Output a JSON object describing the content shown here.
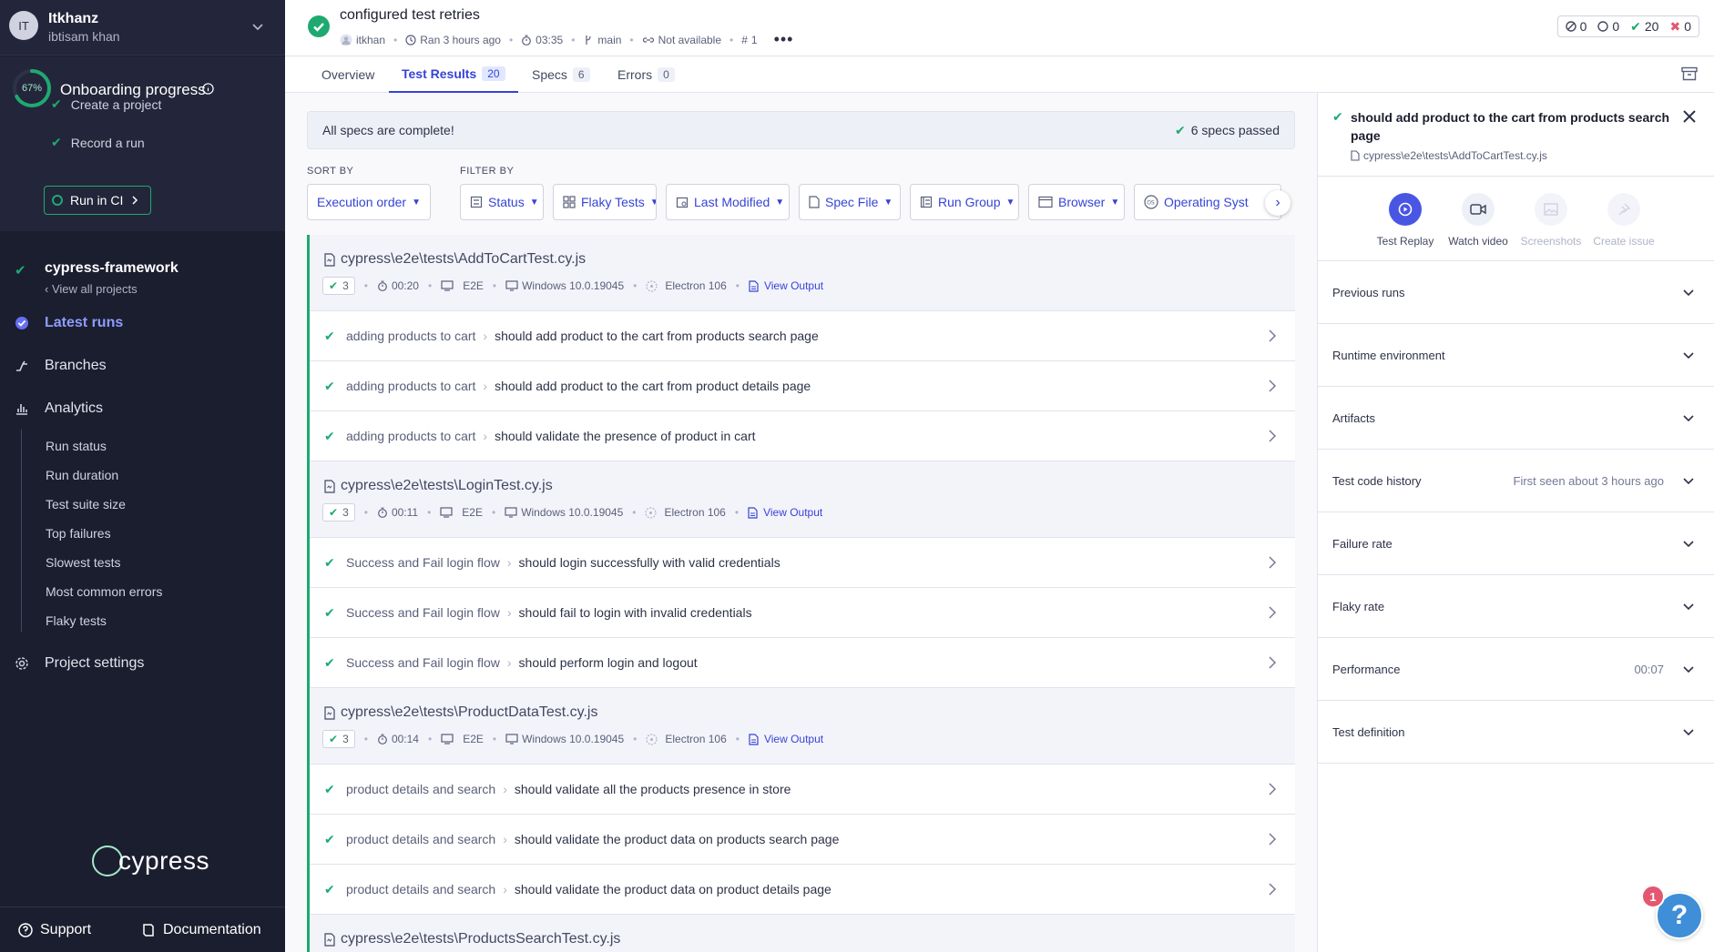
{
  "org": {
    "initials": "IT",
    "name": "Itkhanz",
    "user": "ibtisam khan"
  },
  "onboarding": {
    "percent": "67%",
    "progress": 0.67,
    "title": "Onboarding progress",
    "steps": [
      "Create a project",
      "Record a run"
    ],
    "cta": "Run in CI"
  },
  "project": {
    "name": "cypress-framework",
    "link": "View all projects"
  },
  "nav": {
    "latest_runs": "Latest runs",
    "branches": "Branches",
    "analytics": "Analytics",
    "analytics_items": [
      "Run status",
      "Run duration",
      "Test suite size",
      "Top failures",
      "Slowest tests",
      "Most common errors",
      "Flaky tests"
    ],
    "project_settings": "Project settings"
  },
  "logo_text": "cypress",
  "footer": {
    "support": "Support",
    "documentation": "Documentation"
  },
  "run": {
    "title": "configured test retries",
    "user": "itkhan",
    "ran": "Ran 3 hours ago",
    "duration": "03:35",
    "branch": "main",
    "commit": "Not available",
    "number": "1",
    "counts": {
      "skipped": "0",
      "pending": "0",
      "passed": "20",
      "failed": "0"
    }
  },
  "tabs": [
    {
      "label": "Overview",
      "count": ""
    },
    {
      "label": "Test Results",
      "count": "20"
    },
    {
      "label": "Specs",
      "count": "6"
    },
    {
      "label": "Errors",
      "count": "0"
    }
  ],
  "banner": {
    "left": "All specs are complete!",
    "right": "6 specs passed"
  },
  "sort": {
    "label": "SORT BY",
    "value": "Execution order"
  },
  "filter": {
    "label": "FILTER BY",
    "items": [
      "Status",
      "Flaky Tests",
      "Last Modified",
      "Spec File",
      "Run Group",
      "Browser",
      "Operating Syst"
    ]
  },
  "specs": [
    {
      "file": "cypress\\e2e\\tests\\AddToCartTest.cy.js",
      "passed": "3",
      "duration": "00:20",
      "type": "E2E",
      "os": "Windows 10.0.19045",
      "browser": "Electron 106",
      "output": "View Output",
      "tests": [
        {
          "suite": "adding products to cart",
          "title": "should add product to the cart from products search page"
        },
        {
          "suite": "adding products to cart",
          "title": "should add product to the cart from product details page"
        },
        {
          "suite": "adding products to cart",
          "title": "should validate the presence of product in cart"
        }
      ]
    },
    {
      "file": "cypress\\e2e\\tests\\LoginTest.cy.js",
      "passed": "3",
      "duration": "00:11",
      "type": "E2E",
      "os": "Windows 10.0.19045",
      "browser": "Electron 106",
      "output": "View Output",
      "tests": [
        {
          "suite": "Success and Fail login flow",
          "title": "should login successfully with valid credentials"
        },
        {
          "suite": "Success and Fail login flow",
          "title": "should fail to login with invalid credentials"
        },
        {
          "suite": "Success and Fail login flow",
          "title": "should perform login and logout"
        }
      ]
    },
    {
      "file": "cypress\\e2e\\tests\\ProductDataTest.cy.js",
      "passed": "3",
      "duration": "00:14",
      "type": "E2E",
      "os": "Windows 10.0.19045",
      "browser": "Electron 106",
      "output": "View Output",
      "tests": [
        {
          "suite": "product details and search",
          "title": "should validate all the products presence in store"
        },
        {
          "suite": "product details and search",
          "title": "should validate the product data on products search page"
        },
        {
          "suite": "product details and search",
          "title": "should validate the product data on product details page"
        }
      ]
    },
    {
      "file": "cypress\\e2e\\tests\\ProductsSearchTest.cy.js",
      "tests": []
    }
  ],
  "panel": {
    "title": "should add product to the cart from products search page",
    "file": "cypress\\e2e\\tests\\AddToCartTest.cy.js",
    "actions": [
      "Test Replay",
      "Watch video",
      "Screenshots",
      "Create issue"
    ],
    "sections": [
      {
        "label": "Previous runs",
        "value": ""
      },
      {
        "label": "Runtime environment",
        "value": ""
      },
      {
        "label": "Artifacts",
        "value": ""
      },
      {
        "label": "Test code history",
        "value": "First seen about 3 hours ago"
      },
      {
        "label": "Failure rate",
        "value": ""
      },
      {
        "label": "Flaky rate",
        "value": ""
      },
      {
        "label": "Performance",
        "value": "00:07"
      },
      {
        "label": "Test definition",
        "value": ""
      }
    ]
  },
  "help": {
    "glyph": "?",
    "badge": "1"
  },
  "colors": {
    "sidebar_bg": "#1b1e2e",
    "accent": "#3743d6",
    "pass": "#1fa971",
    "fail": "#e45770"
  }
}
